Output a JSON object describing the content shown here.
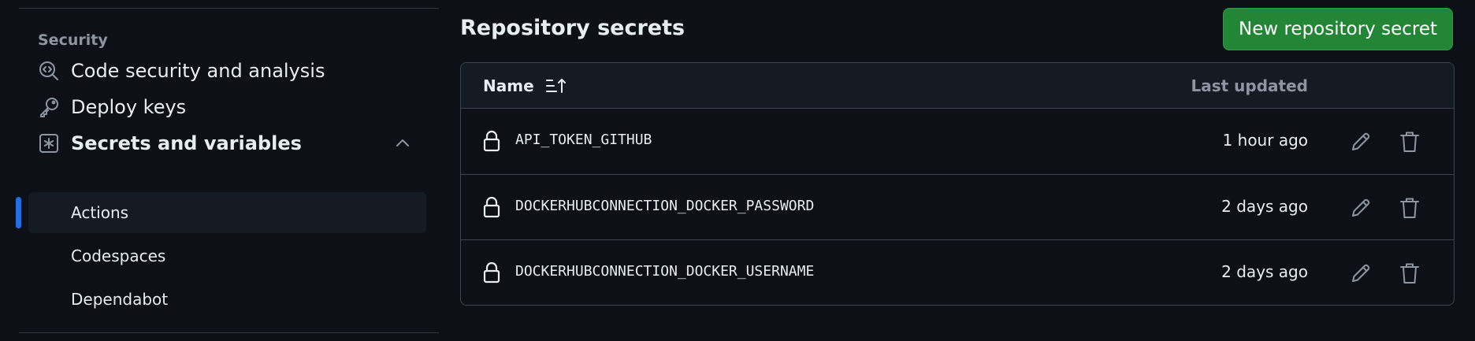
{
  "sidebar": {
    "section_heading": "Security",
    "items": [
      {
        "label": "Code security and analysis",
        "icon": "codescan-icon"
      },
      {
        "label": "Deploy keys",
        "icon": "key-icon"
      },
      {
        "label": "Secrets and variables",
        "icon": "asterisk-box-icon",
        "expanded": true
      }
    ],
    "sub_items": [
      {
        "label": "Actions",
        "active": true
      },
      {
        "label": "Codespaces",
        "active": false
      },
      {
        "label": "Dependabot",
        "active": false
      }
    ]
  },
  "main": {
    "title": "Repository secrets",
    "new_button": "New repository secret",
    "table": {
      "col_name": "Name",
      "col_updated": "Last updated",
      "rows": [
        {
          "name": "API_TOKEN_GITHUB",
          "updated": "1 hour ago"
        },
        {
          "name": "DOCKERHUBCONNECTION_DOCKER_PASSWORD",
          "updated": "2 days ago"
        },
        {
          "name": "DOCKERHUBCONNECTION_DOCKER_USERNAME",
          "updated": "2 days ago"
        }
      ]
    }
  },
  "colors": {
    "background": "#0d1117",
    "primary_button": "#238636",
    "active_indicator": "#1f6feb",
    "border": "#3d444d"
  }
}
